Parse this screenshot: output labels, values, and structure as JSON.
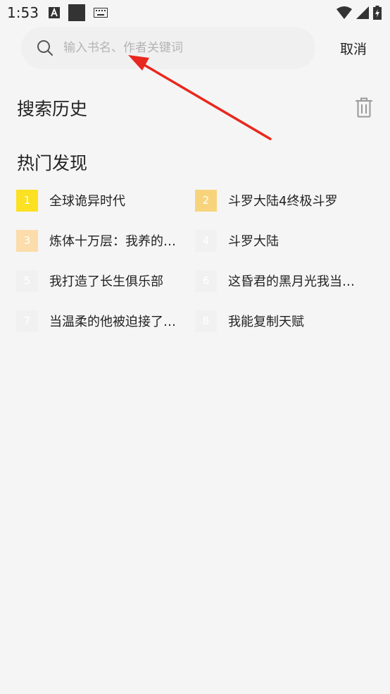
{
  "status_bar": {
    "time": "1:53"
  },
  "search": {
    "placeholder": "输入书名、作者关键词",
    "value": "",
    "cancel_label": "取消"
  },
  "history": {
    "title": "搜索历史"
  },
  "hot": {
    "title": "热门发现",
    "items": [
      {
        "rank": "1",
        "title": "全球诡异时代",
        "badge_color": "#fbe122"
      },
      {
        "rank": "2",
        "title": "斗罗大陆4终极斗罗",
        "badge_color": "#f7d47c"
      },
      {
        "rank": "3",
        "title": "炼体十万层：我养的…",
        "badge_color": "#fbdcaa"
      },
      {
        "rank": "4",
        "title": "斗罗大陆",
        "badge_color": "#f1f1f1"
      },
      {
        "rank": "5",
        "title": "我打造了长生俱乐部",
        "badge_color": "#f1f1f1"
      },
      {
        "rank": "6",
        "title": "这昏君的黑月光我当…",
        "badge_color": "#f1f1f1"
      },
      {
        "rank": "7",
        "title": "当温柔的他被迫接了…",
        "badge_color": "#f1f1f1"
      },
      {
        "rank": "8",
        "title": "我能复制天赋",
        "badge_color": "#f1f1f1"
      }
    ]
  },
  "icons": {
    "search": "search-icon",
    "trash": "trash-icon"
  },
  "colors": {
    "background": "#f5f5f5",
    "search_bg": "#f0f0f0",
    "annotation_arrow": "#e8281e"
  }
}
